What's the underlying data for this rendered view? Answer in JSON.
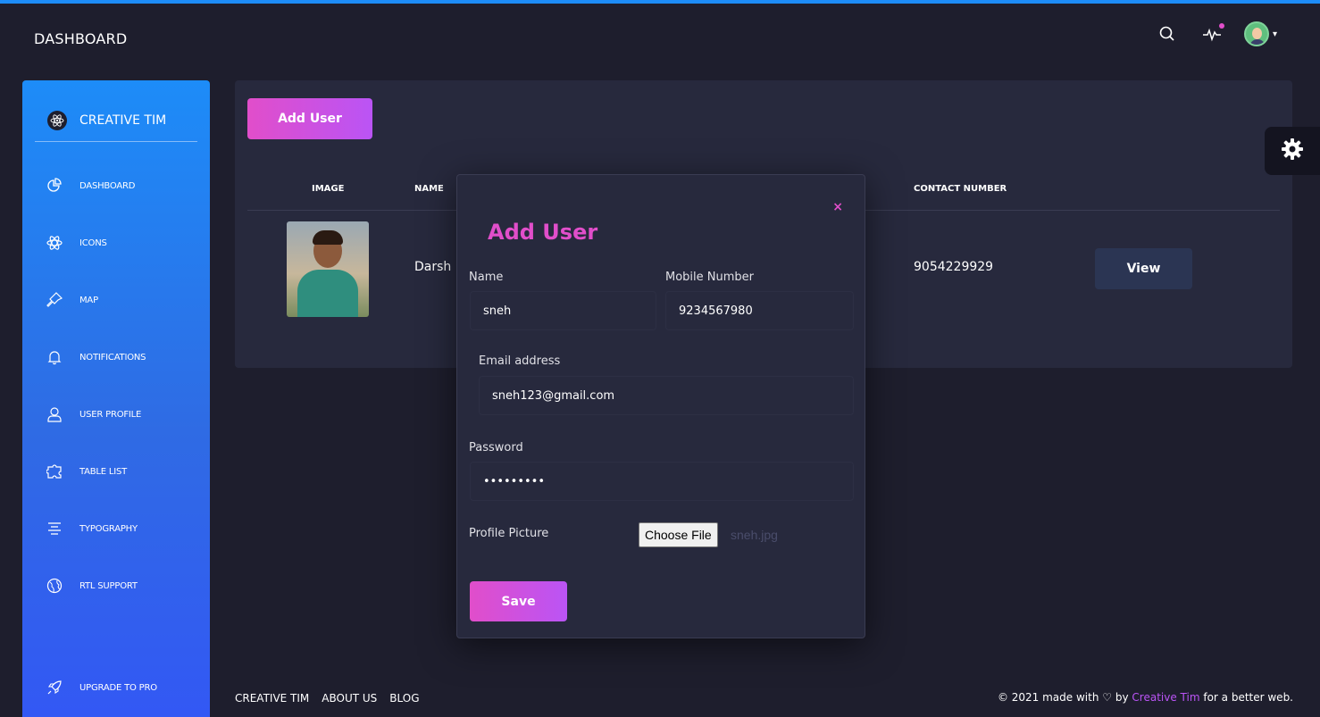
{
  "colors": {
    "background": "#1e1e2d",
    "card": "#27293d",
    "accent_pink": "#e14eca",
    "accent_purple": "#ba54f5",
    "sidebar_top": "#1d8cf8",
    "sidebar_bottom": "#3358f4",
    "view_button": "#2b3553"
  },
  "header": {
    "title": "DASHBOARD",
    "icons": [
      "search-icon",
      "activity-icon",
      "avatar",
      "chevron-down-icon"
    ]
  },
  "sidebar": {
    "brand": "CREATIVE TIM",
    "brand_icon": "react-atom-icon",
    "items": [
      {
        "label": "DASHBOARD",
        "icon": "chart-pie-icon"
      },
      {
        "label": "ICONS",
        "icon": "atom-icon"
      },
      {
        "label": "MAP",
        "icon": "pin-icon"
      },
      {
        "label": "NOTIFICATIONS",
        "icon": "bell-icon"
      },
      {
        "label": "USER PROFILE",
        "icon": "user-icon"
      },
      {
        "label": "TABLE LIST",
        "icon": "puzzle-icon"
      },
      {
        "label": "TYPOGRAPHY",
        "icon": "align-center-icon"
      },
      {
        "label": "RTL SUPPORT",
        "icon": "world-icon"
      },
      {
        "label": "UPGRADE TO PRO",
        "icon": "spaceship-icon"
      }
    ]
  },
  "main": {
    "add_user_label": "Add User",
    "table": {
      "headers": [
        "IMAGE",
        "NAME",
        "CONTACT NUMBER"
      ],
      "rows": [
        {
          "name": "Darsh",
          "contact": "9054229929",
          "action": "View"
        }
      ]
    }
  },
  "modal": {
    "title": "Add User",
    "close": "×",
    "name_label": "Name",
    "name_value": "sneh",
    "mobile_label": "Mobile Number",
    "mobile_value": "9234567980",
    "email_label": "Email address",
    "email_value": "sneh123@gmail.com",
    "password_label": "Password",
    "password_value": "•••••••••",
    "picture_label": "Profile Picture",
    "file_button": "Choose File",
    "file_name": "sneh.jpg",
    "save_label": "Save"
  },
  "footer": {
    "links": [
      "CREATIVE TIM",
      "ABOUT US",
      "BLOG"
    ],
    "copyright_prefix": "© 2021 made with",
    "copyright_by": "by",
    "copyright_link": "Creative Tim",
    "copyright_suffix": "for a better web."
  }
}
